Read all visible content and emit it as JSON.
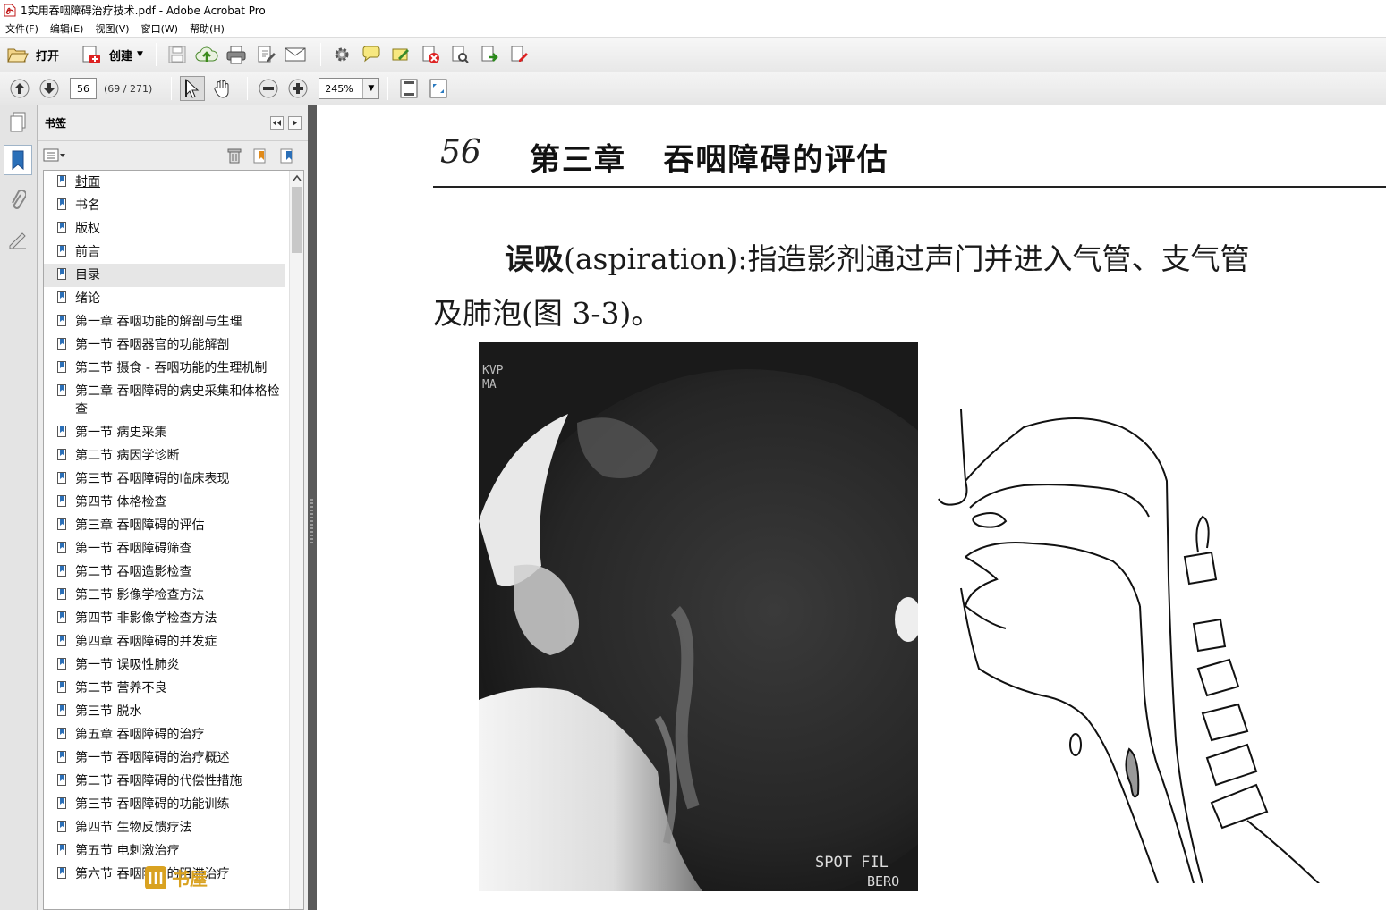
{
  "window": {
    "title": "1实用吞咽障碍治疗技术.pdf - Adobe Acrobat Pro"
  },
  "menu": [
    "文件(F)",
    "编辑(E)",
    "视图(V)",
    "窗口(W)",
    "帮助(H)"
  ],
  "toolbar": {
    "open_label": "打开",
    "create_label": "创建"
  },
  "nav": {
    "page_input": "56",
    "page_count": "(69 / 271)",
    "zoom": "245%"
  },
  "bookmarks": {
    "title": "书签",
    "items": [
      {
        "label": "封面",
        "underline": true
      },
      {
        "label": "书名"
      },
      {
        "label": "版权"
      },
      {
        "label": "前言"
      },
      {
        "label": "目录",
        "selected": true
      },
      {
        "label": "绪论"
      },
      {
        "label": "第一章  吞咽功能的解剖与生理"
      },
      {
        "label": "第一节  吞咽器官的功能解剖"
      },
      {
        "label": "第二节  摄食 - 吞咽功能的生理机制"
      },
      {
        "label": "第二章  吞咽障碍的病史采集和体格检查"
      },
      {
        "label": "第一节  病史采集"
      },
      {
        "label": "第二节  病因学诊断"
      },
      {
        "label": "第三节  吞咽障碍的临床表现"
      },
      {
        "label": "第四节  体格检查"
      },
      {
        "label": "第三章  吞咽障碍的评估"
      },
      {
        "label": "第一节  吞咽障碍筛查"
      },
      {
        "label": "第二节  吞咽造影检查"
      },
      {
        "label": "第三节  影像学检查方法"
      },
      {
        "label": "第四节  非影像学检查方法"
      },
      {
        "label": "第四章  吞咽障碍的并发症"
      },
      {
        "label": "第一节  误吸性肺炎"
      },
      {
        "label": "第二节  营养不良"
      },
      {
        "label": "第三节  脱水"
      },
      {
        "label": "第五章  吞咽障碍的治疗"
      },
      {
        "label": "第一节  吞咽障碍的治疗概述"
      },
      {
        "label": "第二节  吞咽障碍的代偿性措施"
      },
      {
        "label": "第三节  吞咽障碍的功能训练"
      },
      {
        "label": "第四节  生物反馈疗法"
      },
      {
        "label": "第五节  电刺激治疗"
      },
      {
        "label": "第六节  吞咽障碍的阻滞治疗"
      }
    ]
  },
  "document": {
    "page_number": "56",
    "chapter_heading": "第三章   吞咽障碍的评估",
    "term": "误吸",
    "para_line1": "(aspiration):指造影剂通过声门并进入气管、支气管",
    "para_line2": "及肺泡(图 3-3)。",
    "xray_text_top": "KVP\nMA",
    "xray_text_bottom1": "SPOT FIL",
    "xray_text_bottom2": "BERO"
  },
  "watermark": {
    "text": "书屋"
  }
}
